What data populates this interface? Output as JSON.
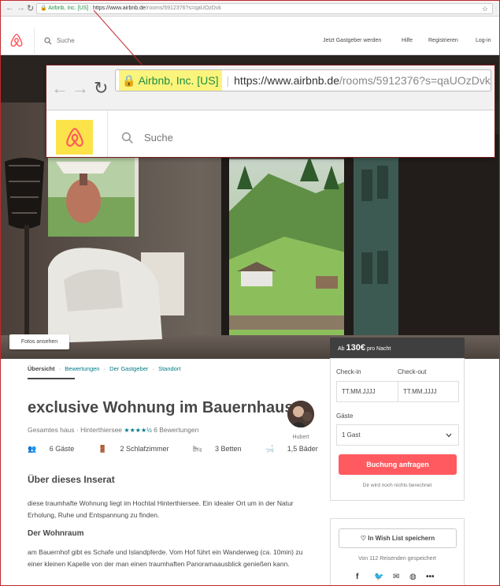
{
  "browser": {
    "back": "←",
    "forward": "→",
    "reload": "↻",
    "secure_label": "Airbnb, Inc. [US]",
    "url_host": "https://www.airbnb.de",
    "url_path": "/rooms/5912376?s=qaUOzDvk",
    "star": "☆"
  },
  "header": {
    "search_placeholder": "Suche",
    "links": [
      "Jetzt Gastgeber werden",
      "Hilfe",
      "Registrieren",
      "Log-in"
    ]
  },
  "zoom": {
    "secure_label": "Airbnb, Inc. [US]",
    "url_host": "https://www.airbnb.de",
    "url_path": "/rooms/5912376?s=qaUOzDvk",
    "search_placeholder": "Suche"
  },
  "hero": {
    "photos_button": "Fotos ansehen"
  },
  "booking": {
    "price_prefix": "Ab",
    "price": "130€",
    "price_suffix": "pro Nacht",
    "checkin_label": "Check-in",
    "checkout_label": "Check-out",
    "checkin_placeholder": "TT.MM.JJJJ",
    "checkout_placeholder": "TT.MM.JJJJ",
    "guests_label": "Gäste",
    "guests_value": "1 Gast",
    "book_button": "Buchung anfragen",
    "no_charge_note": "Dir wird noch nichts berechnet"
  },
  "wishlist": {
    "button": "In Wish List speichern",
    "saved_count": "Von 112 Reisenden gespeichert"
  },
  "listing": {
    "subnav": [
      "Übersicht",
      "Bewertungen",
      "Der Gastgeber",
      "Standort"
    ],
    "title": "exclusive Wohnung im Bauernhaus",
    "type": "Gesamtes haus",
    "location": "Hinterthiersee",
    "stars": "★★★★½",
    "rating_value": 4.5,
    "reviews": "6 Bewertungen",
    "host_name": "Hubert",
    "amenities": [
      "6 Gäste",
      "2 Schlafzimmer",
      "3 Betten",
      "1,5 Bäder"
    ],
    "about_heading": "Über dieses Inserat",
    "about_text": "diese traumhafte Wohnung liegt im Hochtal Hinterthiersee. Ein idealer Ort um in der Natur Erholung, Ruhe und Entspannung zu finden.",
    "wohnraum_heading": "Der Wohnraum",
    "wohnraum_text": "am Bauernhof gibt es Schafe und Islandpferde. Vom Hof führt ein Wanderweg (ca. 10min) zu einer kleinen Kapelle von der man einen traumhaften Panoramaausblick genießen kann."
  },
  "colors": {
    "brand": "#ff5a5f",
    "secure_green": "#1e8e3e",
    "highlight_yellow": "#fbf47c",
    "accent_teal": "#007a87",
    "callout_red": "#c0282d"
  }
}
